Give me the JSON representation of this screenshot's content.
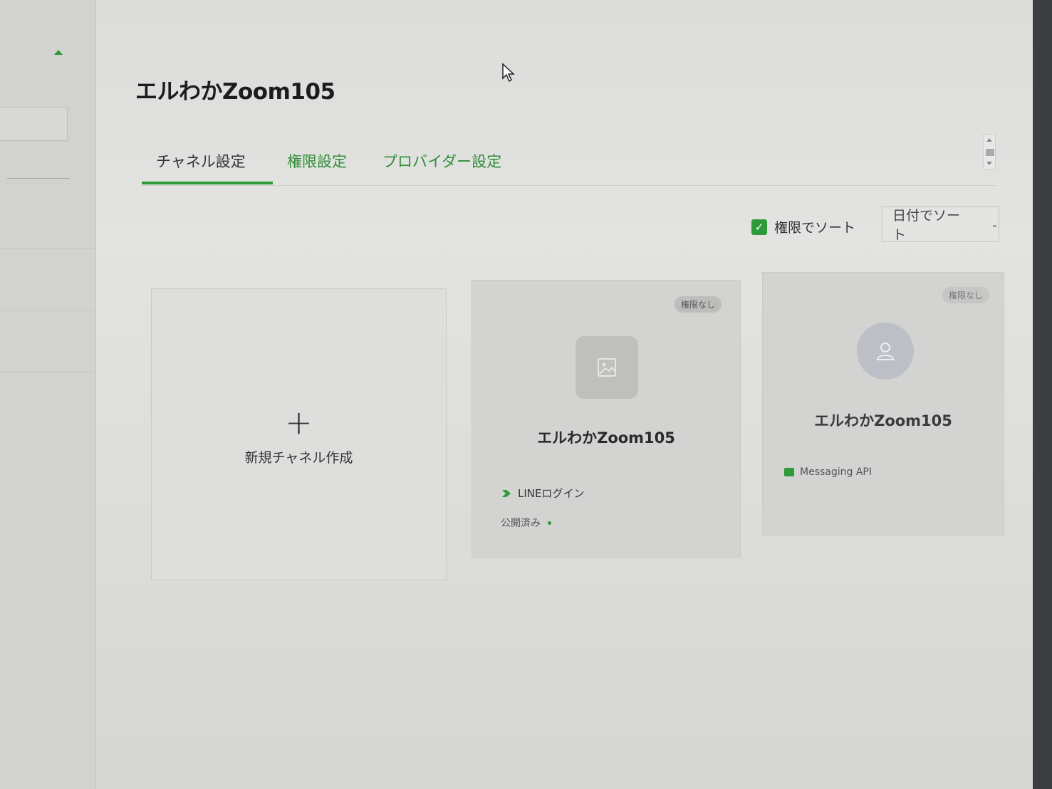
{
  "header": {
    "title": "エルわかZoom105"
  },
  "tabs": [
    {
      "label": "チャネル設定",
      "active": true
    },
    {
      "label": "権限設定",
      "active": false
    },
    {
      "label": "プロバイダー設定",
      "active": false
    }
  ],
  "toolbar": {
    "sort_by_permission_label": "権限でソート",
    "sort_by_permission_checked": true,
    "sort_select_value": "日付でソート"
  },
  "new_channel": {
    "plus": "+",
    "label": "新規チャネル作成"
  },
  "channels": [
    {
      "badge": "権限なし",
      "name": "エルわかZoom105",
      "type": "LINEログイン",
      "status": "公開済み",
      "icon": "image-placeholder-icon"
    },
    {
      "badge": "権限なし",
      "name": "エルわかZoom105",
      "type": "Messaging API",
      "icon": "user-avatar-icon"
    }
  ],
  "colors": {
    "accent": "#2e9b3a",
    "card_bg": "#d3d3d1",
    "badge_bg": "#bdbdbb"
  }
}
